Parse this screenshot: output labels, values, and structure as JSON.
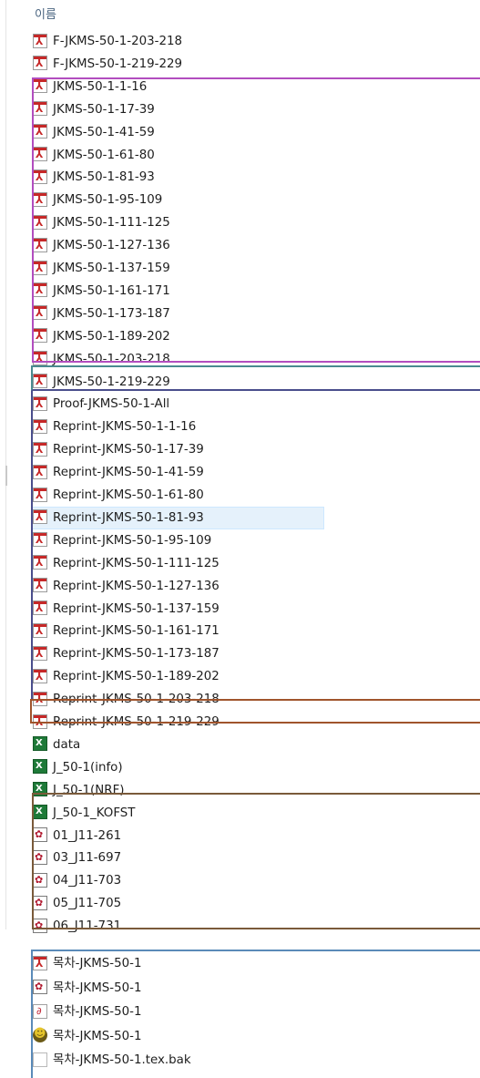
{
  "header": {
    "name_col": "이름"
  },
  "files": [
    {
      "name": "F-JKMS-50-1-203-218",
      "icon": "pdf-icon"
    },
    {
      "name": "F-JKMS-50-1-219-229",
      "icon": "pdf-icon"
    },
    {
      "name": "JKMS-50-1-1-16",
      "icon": "pdf-icon"
    },
    {
      "name": "JKMS-50-1-17-39",
      "icon": "pdf-icon"
    },
    {
      "name": "JKMS-50-1-41-59",
      "icon": "pdf-icon"
    },
    {
      "name": "JKMS-50-1-61-80",
      "icon": "pdf-icon"
    },
    {
      "name": "JKMS-50-1-81-93",
      "icon": "pdf-icon"
    },
    {
      "name": "JKMS-50-1-95-109",
      "icon": "pdf-icon"
    },
    {
      "name": "JKMS-50-1-111-125",
      "icon": "pdf-icon"
    },
    {
      "name": "JKMS-50-1-127-136",
      "icon": "pdf-icon"
    },
    {
      "name": "JKMS-50-1-137-159",
      "icon": "pdf-icon"
    },
    {
      "name": "JKMS-50-1-161-171",
      "icon": "pdf-icon"
    },
    {
      "name": "JKMS-50-1-173-187",
      "icon": "pdf-icon"
    },
    {
      "name": "JKMS-50-1-189-202",
      "icon": "pdf-icon"
    },
    {
      "name": "JKMS-50-1-203-218",
      "icon": "pdf-icon"
    },
    {
      "name": "JKMS-50-1-219-229",
      "icon": "pdf-icon"
    },
    {
      "name": "Proof-JKMS-50-1-All",
      "icon": "pdf-icon"
    },
    {
      "name": "Reprint-JKMS-50-1-1-16",
      "icon": "pdf-icon"
    },
    {
      "name": "Reprint-JKMS-50-1-17-39",
      "icon": "pdf-icon"
    },
    {
      "name": "Reprint-JKMS-50-1-41-59",
      "icon": "pdf-icon"
    },
    {
      "name": "Reprint-JKMS-50-1-61-80",
      "icon": "pdf-icon"
    },
    {
      "name": "Reprint-JKMS-50-1-81-93",
      "icon": "pdf-icon",
      "selected": true
    },
    {
      "name": "Reprint-JKMS-50-1-95-109",
      "icon": "pdf-icon"
    },
    {
      "name": "Reprint-JKMS-50-1-111-125",
      "icon": "pdf-icon"
    },
    {
      "name": "Reprint-JKMS-50-1-127-136",
      "icon": "pdf-icon"
    },
    {
      "name": "Reprint-JKMS-50-1-137-159",
      "icon": "pdf-icon"
    },
    {
      "name": "Reprint-JKMS-50-1-161-171",
      "icon": "pdf-icon"
    },
    {
      "name": "Reprint-JKMS-50-1-173-187",
      "icon": "pdf-icon"
    },
    {
      "name": "Reprint-JKMS-50-1-189-202",
      "icon": "pdf-icon"
    },
    {
      "name": "Reprint-JKMS-50-1-203-218",
      "icon": "pdf-icon"
    },
    {
      "name": "Reprint-JKMS-50-1-219-229",
      "icon": "pdf-icon"
    },
    {
      "name": "data",
      "icon": "excel-icon"
    },
    {
      "name": "J_50-1(info)",
      "icon": "excel-icon"
    },
    {
      "name": "J_50-1(NRF)",
      "icon": "excel-icon"
    },
    {
      "name": "J_50-1_KOFST",
      "icon": "excel-icon"
    },
    {
      "name": "01_J11-261",
      "icon": "dvi-icon"
    },
    {
      "name": "03_J11-697",
      "icon": "dvi-icon"
    },
    {
      "name": "04_J11-703",
      "icon": "dvi-icon"
    },
    {
      "name": "05_J11-705",
      "icon": "dvi-icon"
    },
    {
      "name": "06_J11-731",
      "icon": "dvi-icon"
    }
  ],
  "toc_files": [
    {
      "name": "목차-JKMS-50-1",
      "icon": "pdf-icon"
    },
    {
      "name": "목차-JKMS-50-1",
      "icon": "dvi-icon"
    },
    {
      "name": "목차-JKMS-50-1",
      "icon": "ps-icon"
    },
    {
      "name": "목차-JKMS-50-1",
      "icon": "tex-icon"
    },
    {
      "name": "목차-JKMS-50-1.tex.bak",
      "icon": "blank-file-icon"
    }
  ],
  "highlight_colors": {
    "jkms_group": "#b24dbf",
    "proof_group": "#4a8a90",
    "reprint_group": "#4a4e8c",
    "data_group": "#a0542c",
    "dvi_group": "#7a5a3a",
    "toc_group": "#5a8ab8"
  }
}
